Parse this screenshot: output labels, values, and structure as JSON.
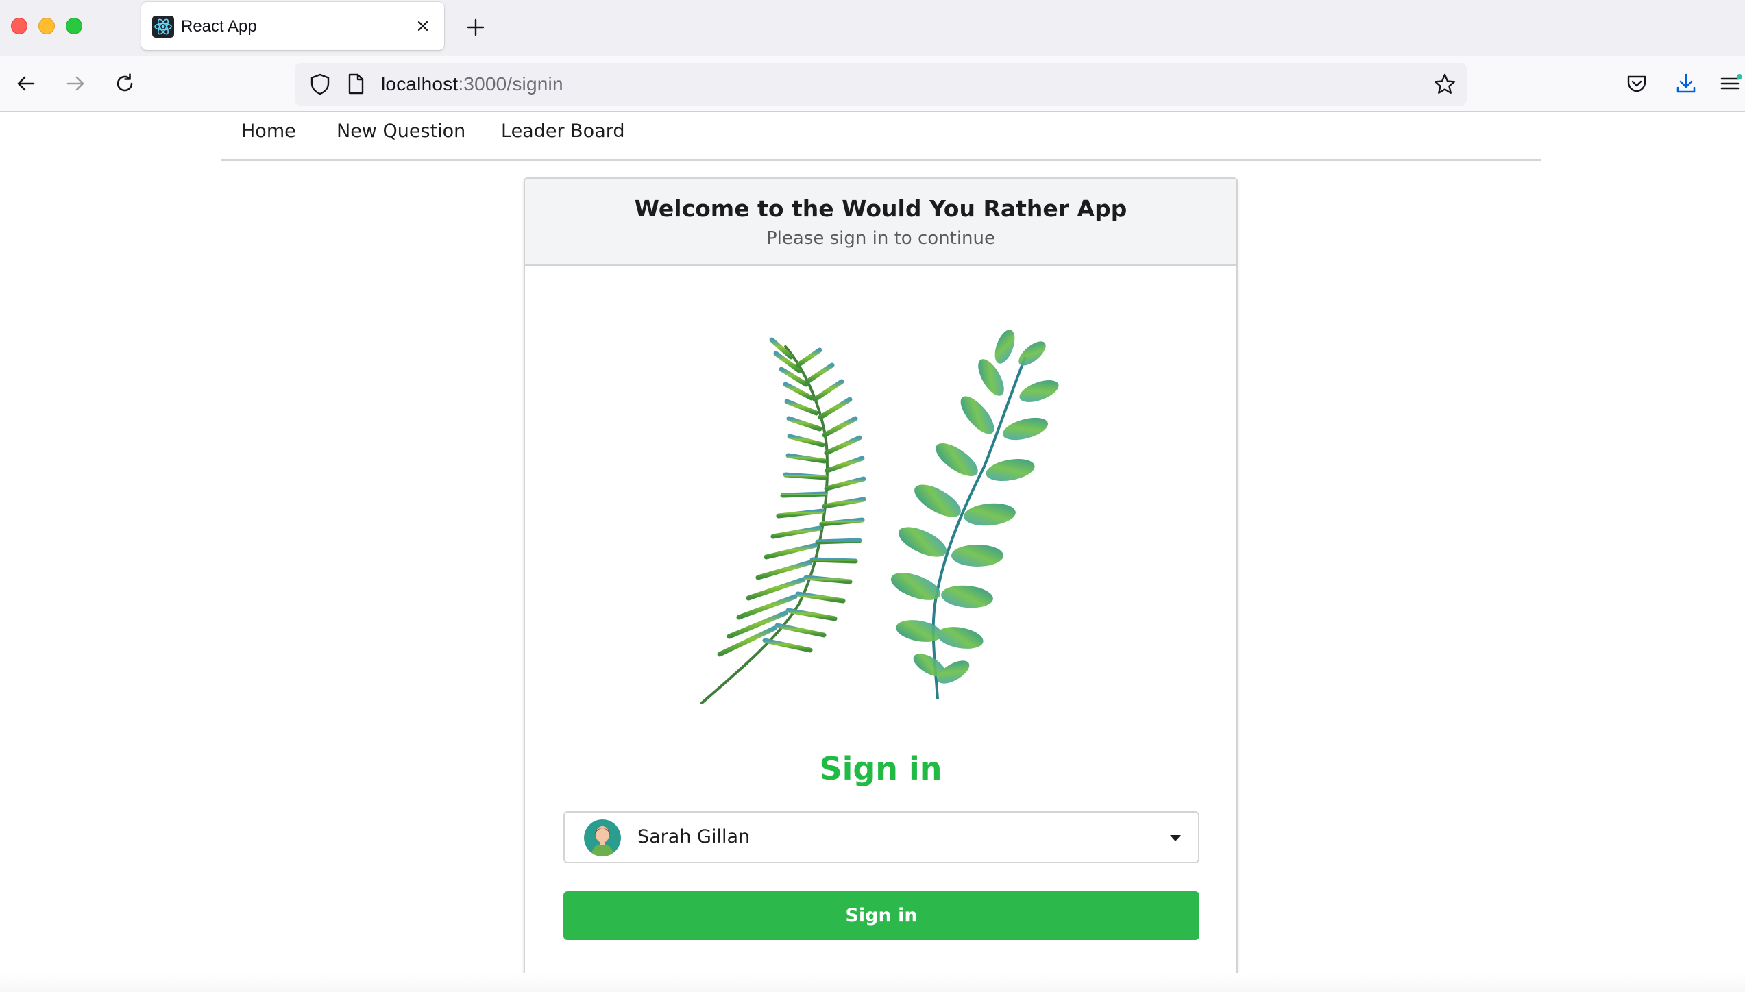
{
  "browser": {
    "tab": {
      "title": "React App",
      "favicon": "react-icon"
    },
    "url": {
      "host": "localhost",
      "path": ":3000/signin"
    },
    "icons": [
      "back-icon",
      "forward-icon",
      "reload-icon",
      "shield-icon",
      "page-icon",
      "star-icon",
      "pocket-icon",
      "download-icon",
      "menu-icon",
      "close-icon",
      "plus-icon"
    ]
  },
  "nav": {
    "items": [
      "Home",
      "New Question",
      "Leader Board"
    ]
  },
  "card": {
    "title": "Welcome to the Would You Rather App",
    "subtitle": "Please sign in to continue",
    "heading": "Sign in",
    "select": {
      "value": "Sarah Gillan",
      "icon": "dropdown-caret-icon"
    },
    "button": "Sign in"
  },
  "colors": {
    "accent_green": "#21ba45",
    "button_green": "#2db84c",
    "window_red": "#ff5f57",
    "window_yellow": "#febc2e",
    "window_green": "#28c840"
  }
}
